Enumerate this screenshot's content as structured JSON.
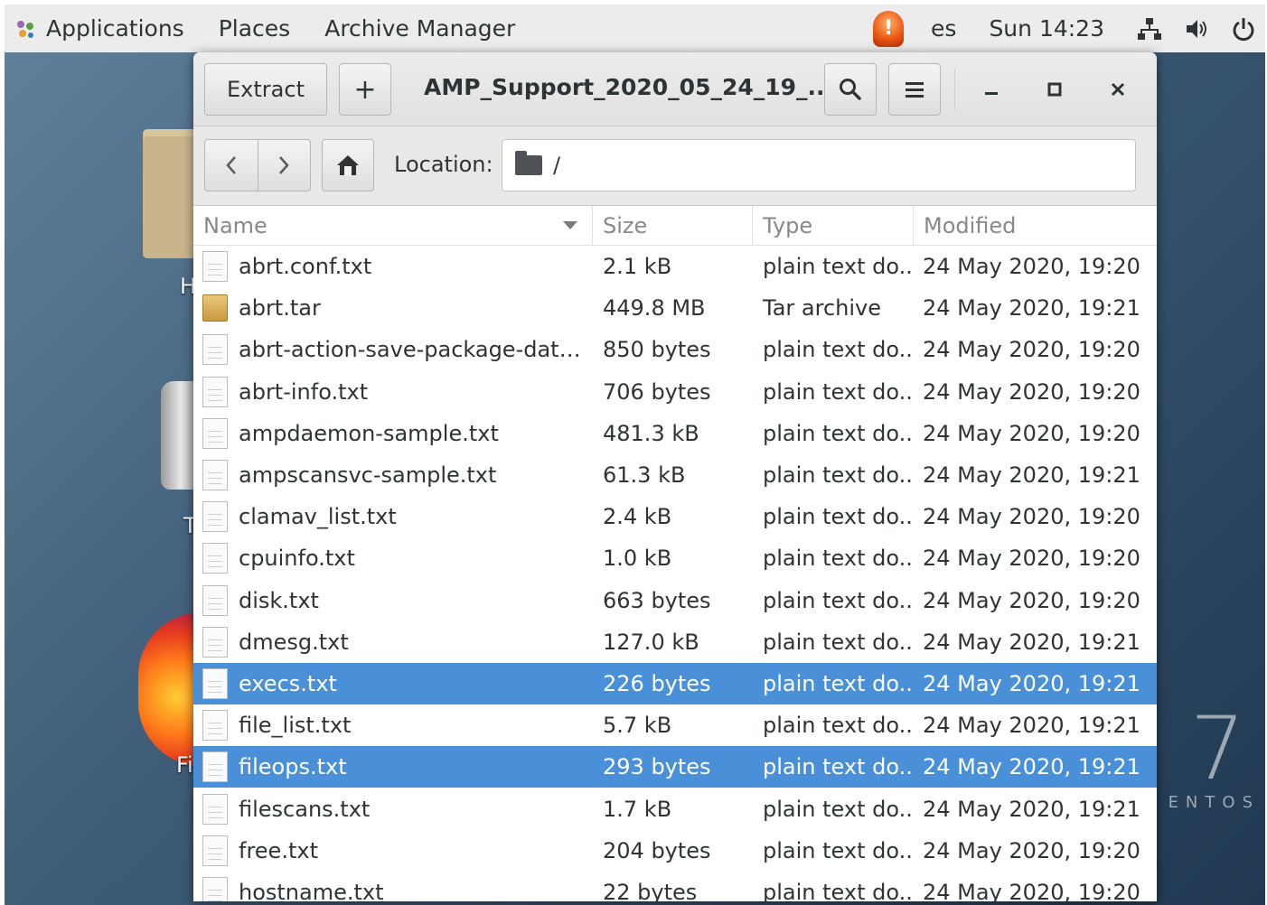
{
  "topbar": {
    "applications": "Applications",
    "places": "Places",
    "app_name": "Archive Manager",
    "keyboard": "es",
    "clock": "Sun 14:23",
    "icons": [
      "alert-icon",
      "network-icon",
      "volume-icon",
      "power-icon"
    ]
  },
  "window": {
    "extract_label": "Extract",
    "add_label": "+",
    "title": "AMP_Support_2020_05_24_19_...",
    "location_label": "Location:",
    "location_value": "/"
  },
  "desktop": {
    "centos_text": "ENTOS",
    "centos_number": "7"
  },
  "columns": {
    "name": "Name",
    "size": "Size",
    "type": "Type",
    "modified": "Modified"
  },
  "files": [
    {
      "name": "abrt.conf.txt",
      "size": "2.1 kB",
      "type": "plain text do...",
      "modified": "24 May 2020, 19:20",
      "icon": "text",
      "selected": false
    },
    {
      "name": "abrt.tar",
      "size": "449.8 MB",
      "type": "Tar archive",
      "modified": "24 May 2020, 19:21",
      "icon": "tar",
      "selected": false
    },
    {
      "name": "abrt-action-save-package-data.c...",
      "size": "850 bytes",
      "type": "plain text do...",
      "modified": "24 May 2020, 19:20",
      "icon": "text",
      "selected": false
    },
    {
      "name": "abrt-info.txt",
      "size": "706 bytes",
      "type": "plain text do...",
      "modified": "24 May 2020, 19:20",
      "icon": "text",
      "selected": false
    },
    {
      "name": "ampdaemon-sample.txt",
      "size": "481.3 kB",
      "type": "plain text do...",
      "modified": "24 May 2020, 19:20",
      "icon": "text",
      "selected": false
    },
    {
      "name": "ampscansvc-sample.txt",
      "size": "61.3 kB",
      "type": "plain text do...",
      "modified": "24 May 2020, 19:21",
      "icon": "text",
      "selected": false
    },
    {
      "name": "clamav_list.txt",
      "size": "2.4 kB",
      "type": "plain text do...",
      "modified": "24 May 2020, 19:20",
      "icon": "text",
      "selected": false
    },
    {
      "name": "cpuinfo.txt",
      "size": "1.0 kB",
      "type": "plain text do...",
      "modified": "24 May 2020, 19:20",
      "icon": "text",
      "selected": false
    },
    {
      "name": "disk.txt",
      "size": "663 bytes",
      "type": "plain text do...",
      "modified": "24 May 2020, 19:20",
      "icon": "text",
      "selected": false
    },
    {
      "name": "dmesg.txt",
      "size": "127.0 kB",
      "type": "plain text do...",
      "modified": "24 May 2020, 19:21",
      "icon": "text",
      "selected": false
    },
    {
      "name": "execs.txt",
      "size": "226 bytes",
      "type": "plain text do...",
      "modified": "24 May 2020, 19:21",
      "icon": "text",
      "selected": true
    },
    {
      "name": "file_list.txt",
      "size": "5.7 kB",
      "type": "plain text do...",
      "modified": "24 May 2020, 19:21",
      "icon": "text",
      "selected": false
    },
    {
      "name": "fileops.txt",
      "size": "293 bytes",
      "type": "plain text do...",
      "modified": "24 May 2020, 19:21",
      "icon": "text",
      "selected": true
    },
    {
      "name": "filescans.txt",
      "size": "1.7 kB",
      "type": "plain text do...",
      "modified": "24 May 2020, 19:21",
      "icon": "text",
      "selected": false
    },
    {
      "name": "free.txt",
      "size": "204 bytes",
      "type": "plain text do...",
      "modified": "24 May 2020, 19:20",
      "icon": "text",
      "selected": false
    },
    {
      "name": "hostname.txt",
      "size": "22 bytes",
      "type": "plain text do...",
      "modified": "24 May 2020, 19:20",
      "icon": "text",
      "selected": false
    }
  ]
}
